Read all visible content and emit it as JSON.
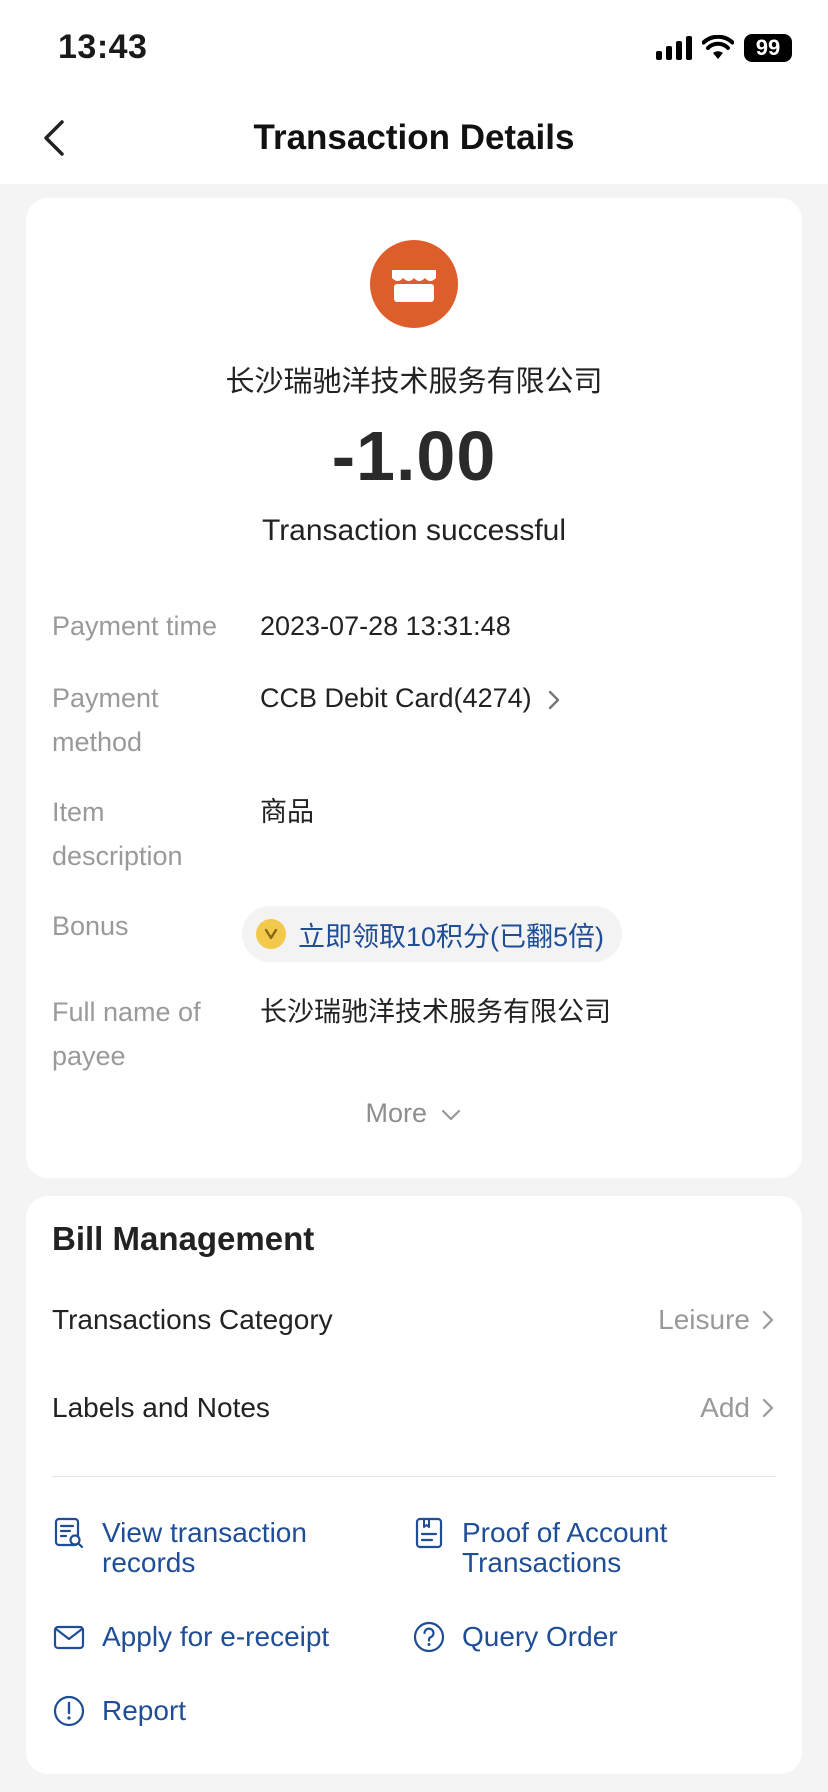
{
  "status_bar": {
    "time": "13:43",
    "battery": "99"
  },
  "nav": {
    "title": "Transaction Details"
  },
  "transaction": {
    "merchant": "长沙瑞驰洋技术服务有限公司",
    "amount": "-1.00",
    "status": "Transaction successful",
    "details": {
      "payment_time_label": "Payment time",
      "payment_time": "2023-07-28 13:31:48",
      "payment_method_label_1": "Payment",
      "payment_method_label_2": "method",
      "payment_method": "CCB Debit Card(4274)",
      "item_label_1": "Item",
      "item_label_2": "description",
      "item": "商品",
      "bonus_label": "Bonus",
      "bonus": "立即领取10积分(已翻5倍)",
      "payee_label_1": "Full name of",
      "payee_label_2": "payee",
      "payee": "长沙瑞驰洋技术服务有限公司"
    },
    "more_label": "More"
  },
  "bill_management": {
    "title": "Bill Management",
    "category_label": "Transactions Category",
    "category_value": "Leisure",
    "notes_label": "Labels and Notes",
    "notes_value": "Add",
    "actions": {
      "view_records_1": "View transaction",
      "view_records_2": "records",
      "proof_1": "Proof of Account",
      "proof_2": "Transactions",
      "e_receipt": "Apply for e-receipt",
      "query_order": "Query Order",
      "report": "Report"
    }
  },
  "colors": {
    "accent_blue": "#1f4e96",
    "merchant_orange": "#dd5e2b",
    "coin_gold": "#f3c94b"
  }
}
